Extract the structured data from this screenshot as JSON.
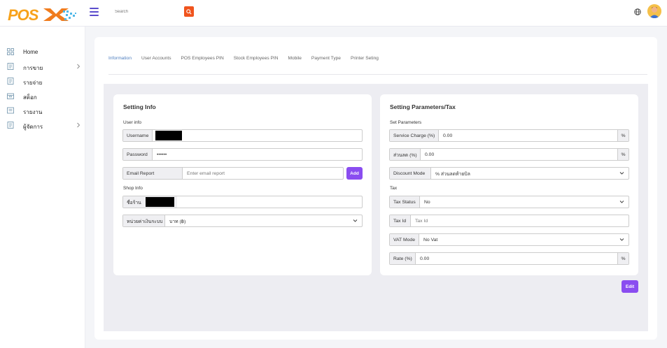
{
  "header": {
    "logo_text": "POSX",
    "search_placeholder": "Search"
  },
  "colors": {
    "accent": "#8a4df0",
    "brand_orange": "#f0541e",
    "active_tab": "#4f7fbf"
  },
  "sidebar": {
    "items": [
      {
        "label": "Home",
        "icon": "grid-icon",
        "has_submenu": false
      },
      {
        "label": "การขาย",
        "icon": "document-icon",
        "has_submenu": true
      },
      {
        "label": "รายจ่าย",
        "icon": "document-icon",
        "has_submenu": false
      },
      {
        "label": "สต็อก",
        "icon": "box-icon",
        "has_submenu": false
      },
      {
        "label": "รายงาน",
        "icon": "report-icon",
        "has_submenu": false
      },
      {
        "label": "ผู้จัดการ",
        "icon": "document-icon",
        "has_submenu": true
      }
    ]
  },
  "tabs": [
    "Information",
    "User Accounts",
    "POS Employees PIN",
    "Stock Employees PIN",
    "Mobile",
    "Payment Type",
    "Printer Seting"
  ],
  "active_tab": "Information",
  "setting_info": {
    "title": "Setting Info",
    "user_info_label": "User info",
    "username_label": "Username",
    "password_label": "Password",
    "password_value": "••••••",
    "email_report_label": "Email Report",
    "email_placeholder": "Enter email report",
    "add_button": "Add",
    "shop_info_label": "Shop Info",
    "shop_name_label": "ชื่อร้าน",
    "currency_label": "หน่วยค่าเงินระบบ",
    "currency_value": "บาท (฿)"
  },
  "setting_params": {
    "title": "Setting Parameters/Tax",
    "set_params_label": "Set Parameters",
    "service_charge_label": "Service Charge (%)",
    "service_charge_value": "0.00",
    "discount_label": "ส่วนลด (%)",
    "discount_value": "0.00",
    "discount_mode_label": "Discount Mode",
    "discount_mode_value": "% ส่วนลดท้ายบิล",
    "tax_label": "Tax",
    "tax_status_label": "Tax Status",
    "tax_status_value": "No",
    "tax_id_label": "Tax Id",
    "tax_id_placeholder": "Tax Id",
    "vat_mode_label": "VAT Mode",
    "vat_mode_value": "No Vat",
    "rate_label": "Rate (%)",
    "rate_value": "0.00",
    "percent_suffix": "%"
  },
  "edit_button": "Edit"
}
